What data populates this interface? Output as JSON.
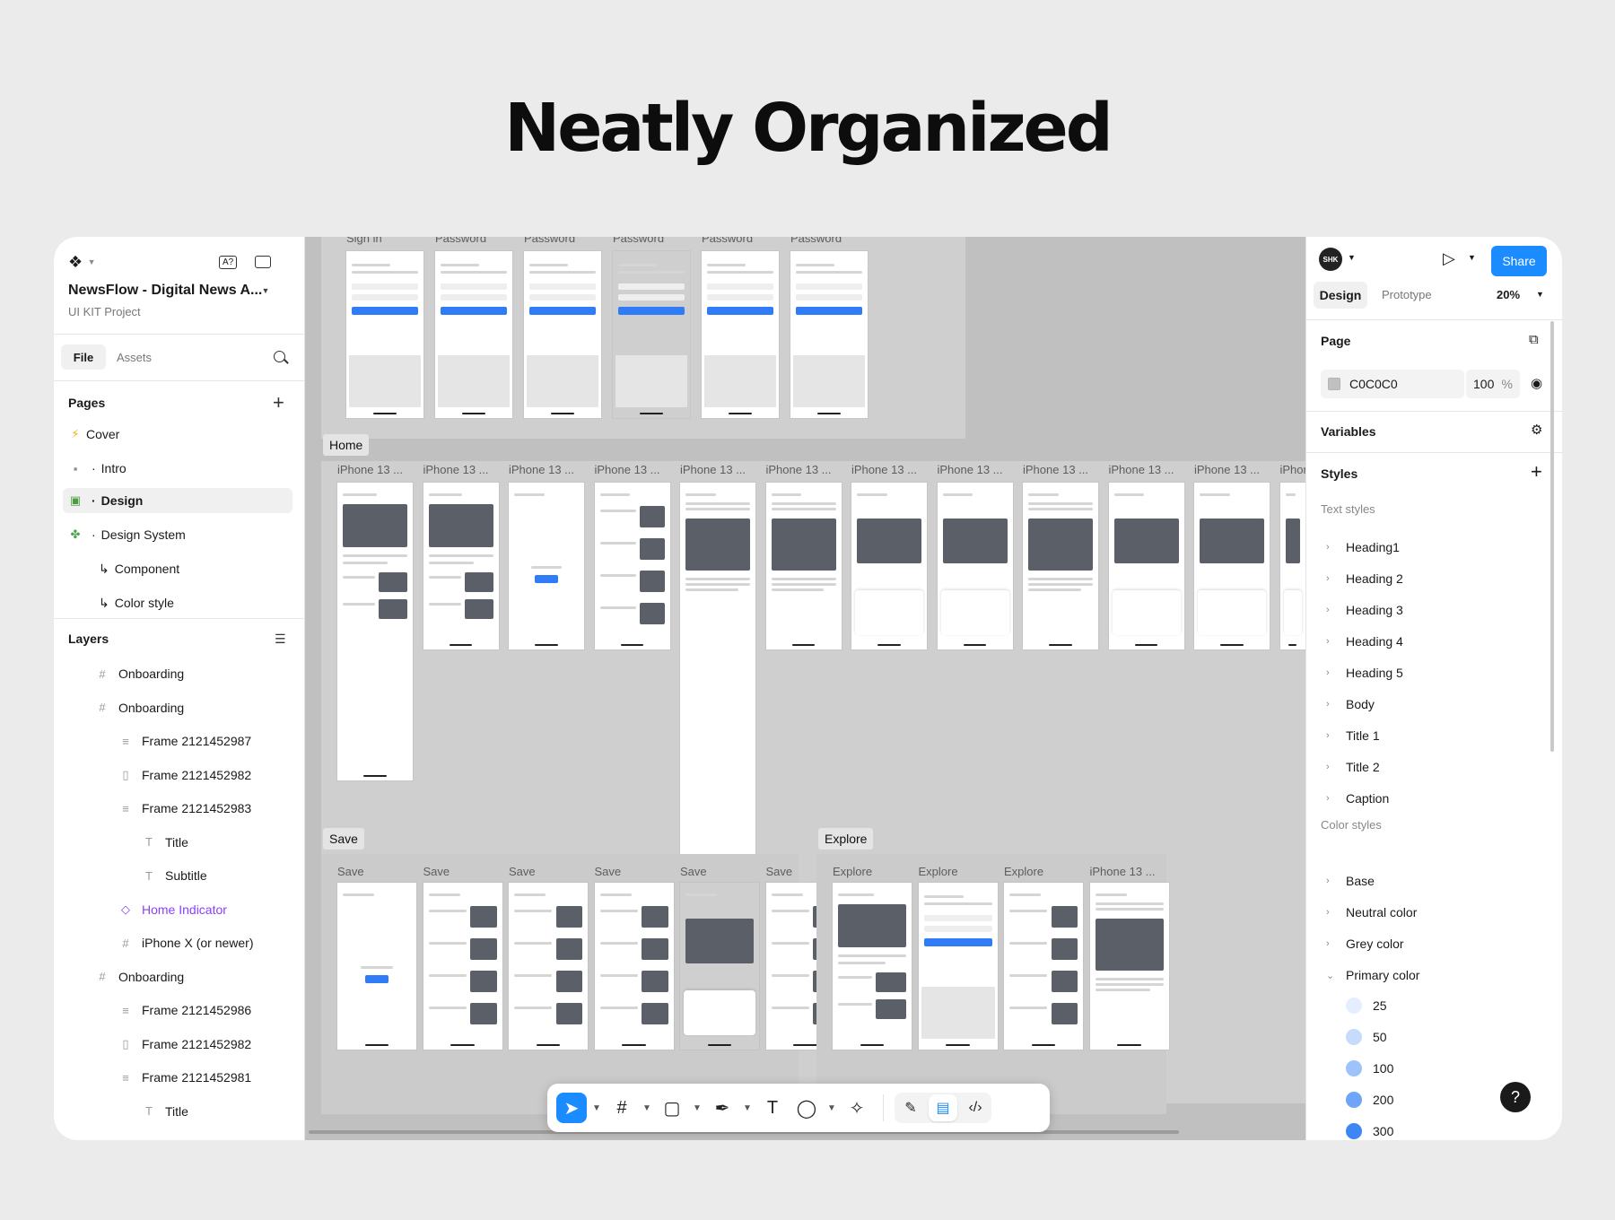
{
  "headline": "Neatly Organized",
  "file": {
    "name": "NewsFlow - Digital News A...",
    "subtitle": "UI KIT Project",
    "tab_file": "File",
    "tab_assets": "Assets",
    "dev_badge": "A?"
  },
  "pages": {
    "title": "Pages",
    "items": [
      {
        "label": "Cover",
        "icon": "⚡"
      },
      {
        "label": "Intro",
        "icon": "▪"
      },
      {
        "label": "Design",
        "icon": "▣"
      },
      {
        "label": "Design System",
        "icon": "✤"
      },
      {
        "label": "Component",
        "icon": "↳"
      },
      {
        "label": "Color style",
        "icon": "↳"
      }
    ]
  },
  "layers": {
    "title": "Layers",
    "items": [
      {
        "label": "Onboarding",
        "icon": "#",
        "indent": 0
      },
      {
        "label": "Onboarding",
        "icon": "#",
        "indent": 0
      },
      {
        "label": "Frame 2121452987",
        "icon": "≡",
        "indent": 1
      },
      {
        "label": "Frame 2121452982",
        "icon": "▯",
        "indent": 1
      },
      {
        "label": "Frame 2121452983",
        "icon": "≡",
        "indent": 1
      },
      {
        "label": "Title",
        "icon": "T",
        "indent": 2
      },
      {
        "label": "Subtitle",
        "icon": "T",
        "indent": 2
      },
      {
        "label": "Home Indicator",
        "icon": "◇",
        "indent": 1,
        "component": true
      },
      {
        "label": "iPhone X (or newer)",
        "icon": "#",
        "indent": 1
      },
      {
        "label": "Onboarding",
        "icon": "#",
        "indent": 0
      },
      {
        "label": "Frame 2121452986",
        "icon": "≡",
        "indent": 1
      },
      {
        "label": "Frame 2121452982",
        "icon": "▯",
        "indent": 1
      },
      {
        "label": "Frame 2121452981",
        "icon": "≡",
        "indent": 1
      },
      {
        "label": "Title",
        "icon": "T",
        "indent": 2
      }
    ]
  },
  "canvas": {
    "auth_frames": [
      "Sign in",
      "Password",
      "Password",
      "Password",
      "Password",
      "Password"
    ],
    "home_label": "Home",
    "home_frames": [
      "iPhone 13 ...",
      "iPhone 13 ...",
      "iPhone 13 ...",
      "iPhone 13 ...",
      "iPhone 13 ...",
      "iPhone 13 ...",
      "iPhone 13 ...",
      "iPhone 13 ...",
      "iPhone 13 ...",
      "iPhone 13 ...",
      "iPhone 13 ...",
      "iPhone"
    ],
    "save_label": "Save",
    "save_frames": [
      "Save",
      "Save",
      "Save",
      "Save",
      "Save",
      "Save"
    ],
    "explore_label": "Explore",
    "explore_frames": [
      "Explore",
      "Explore",
      "Explore",
      "iPhone 13 ..."
    ]
  },
  "right_panel": {
    "avatar": "SHK",
    "share": "Share",
    "tab_design": "Design",
    "tab_prototype": "Prototype",
    "zoom": "20%",
    "page_title": "Page",
    "page_color": "C0C0C0",
    "page_opacity": "100",
    "page_opacity_unit": "%",
    "variables": "Variables",
    "styles": "Styles",
    "text_styles_title": "Text styles",
    "text_styles": [
      "Heading1",
      "Heading 2",
      "Heading 3",
      "Heading 4",
      "Heading 5",
      "Body",
      "Title 1",
      "Title 2",
      "Caption"
    ],
    "color_styles_title": "Color styles",
    "color_styles": [
      "Base",
      "Neutral color",
      "Grey color",
      "Primary color"
    ],
    "primary_shades": [
      {
        "label": "25",
        "color": "#E4EEFE"
      },
      {
        "label": "50",
        "color": "#C6DCFD"
      },
      {
        "label": "100",
        "color": "#9EC3FB"
      },
      {
        "label": "200",
        "color": "#6FA5F8"
      },
      {
        "label": "300",
        "color": "#3F86F5"
      }
    ],
    "help": "?"
  },
  "colors": {
    "accent": "#1A8CFF",
    "canvas_bg": "#C0C0C0",
    "component": "#8A3FFC"
  }
}
